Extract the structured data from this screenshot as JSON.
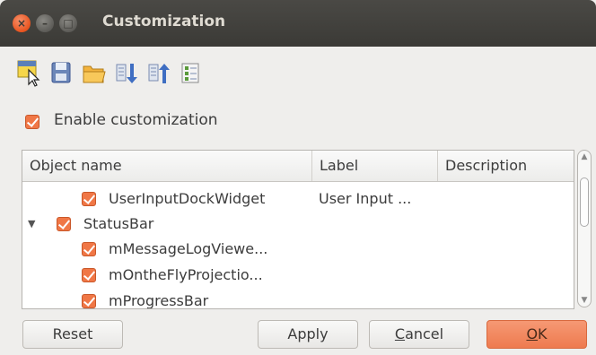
{
  "window": {
    "title": "Customization",
    "controls": {
      "close": "×",
      "minimize": "–",
      "maximize": "□"
    }
  },
  "toolbar": {
    "buttons": [
      {
        "icon": "catch-widget-icon"
      },
      {
        "icon": "save-icon"
      },
      {
        "icon": "open-folder-icon"
      },
      {
        "icon": "expand-all-icon"
      },
      {
        "icon": "collapse-all-icon"
      },
      {
        "icon": "select-all-icon"
      }
    ]
  },
  "enable_customization": {
    "label": "Enable customization",
    "checked": true
  },
  "tree": {
    "columns": [
      "Object name",
      "Label",
      "Description"
    ],
    "rows": [
      {
        "name": "UserInputDockWidget",
        "label": "User Input ...",
        "checked": true
      },
      {
        "name": "StatusBar",
        "label": "",
        "checked": true,
        "expanded": true
      },
      {
        "name": "mMessageLogViewe...",
        "label": "",
        "checked": true
      },
      {
        "name": "mOntheFlyProjectio...",
        "label": "",
        "checked": true
      },
      {
        "name": "mProgressBar",
        "label": "",
        "checked": true
      }
    ]
  },
  "buttons": {
    "reset": "Reset",
    "apply": "Apply",
    "cancel_pre": "",
    "cancel_u": "C",
    "cancel_post": "ancel",
    "ok_u": "O",
    "ok_post": "K"
  },
  "colors": {
    "accent": "#f07746",
    "titlebar": "#3f3e3a"
  }
}
